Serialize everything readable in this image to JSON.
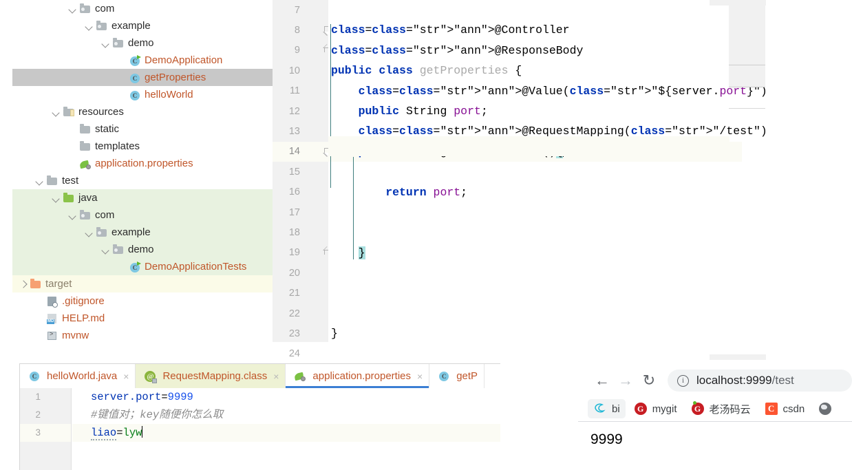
{
  "project_tree": {
    "items": [
      {
        "label": "com",
        "indent": 4,
        "icon": "package-folder-icon",
        "twisty": "down",
        "color": "dark"
      },
      {
        "label": "example",
        "indent": 5,
        "icon": "package-folder-icon",
        "twisty": "down",
        "color": "dark"
      },
      {
        "label": "demo",
        "indent": 6,
        "icon": "package-folder-icon",
        "twisty": "down",
        "color": "dark"
      },
      {
        "label": "DemoApplication",
        "indent": 7,
        "icon": "java-class-runnable-icon",
        "twisty": "none",
        "color": "orange"
      },
      {
        "label": "getProperties",
        "indent": 7,
        "icon": "java-class-icon",
        "twisty": "none",
        "color": "orange",
        "highlight": "selected"
      },
      {
        "label": "helloWorld",
        "indent": 7,
        "icon": "java-class-icon",
        "twisty": "none",
        "color": "orange"
      },
      {
        "label": "resources",
        "indent": 3,
        "icon": "resources-folder-icon",
        "twisty": "down",
        "color": "dark"
      },
      {
        "label": "static",
        "indent": 4,
        "icon": "folder-icon",
        "twisty": "none",
        "color": "dark"
      },
      {
        "label": "templates",
        "indent": 4,
        "icon": "folder-icon",
        "twisty": "none",
        "color": "dark"
      },
      {
        "label": "application.properties",
        "indent": 4,
        "icon": "spring-leaf-icon",
        "twisty": "none",
        "color": "orange"
      },
      {
        "label": "test",
        "indent": 2,
        "icon": "folder-icon",
        "twisty": "down",
        "color": "dark"
      },
      {
        "label": "java",
        "indent": 3,
        "icon": "source-folder-icon",
        "twisty": "down",
        "color": "dark",
        "highlight": "green"
      },
      {
        "label": "com",
        "indent": 4,
        "icon": "package-folder-icon",
        "twisty": "down",
        "color": "dark",
        "highlight": "green"
      },
      {
        "label": "example",
        "indent": 5,
        "icon": "package-folder-icon",
        "twisty": "down",
        "color": "dark",
        "highlight": "green"
      },
      {
        "label": "demo",
        "indent": 6,
        "icon": "package-folder-icon",
        "twisty": "down",
        "color": "dark",
        "highlight": "green"
      },
      {
        "label": "DemoApplicationTests",
        "indent": 7,
        "icon": "java-class-runnable-icon",
        "twisty": "none",
        "color": "orange",
        "highlight": "green"
      },
      {
        "label": "target",
        "indent": 1,
        "icon": "excluded-folder-icon",
        "twisty": "right",
        "color": "gray",
        "highlight": "yellow"
      },
      {
        "label": ".gitignore",
        "indent": 2,
        "icon": "gitignore-icon",
        "twisty": "none",
        "color": "orange"
      },
      {
        "label": "HELP.md",
        "indent": 2,
        "icon": "markdown-icon",
        "twisty": "none",
        "color": "orange"
      },
      {
        "label": "mvnw",
        "indent": 2,
        "icon": "shell-script-icon",
        "twisty": "none",
        "color": "orange"
      }
    ]
  },
  "code_editor": {
    "line_numbers": [
      "7",
      "8",
      "9",
      "10",
      "11",
      "12",
      "13",
      "14",
      "15",
      "16",
      "17",
      "18",
      "19",
      "20",
      "21",
      "22",
      "23",
      "24"
    ],
    "active_line": "14",
    "lines": [
      {
        "num": "7",
        "text": ""
      },
      {
        "num": "8",
        "text": "@Controller"
      },
      {
        "num": "9",
        "text": "@ResponseBody"
      },
      {
        "num": "10",
        "text": "public class getProperties {"
      },
      {
        "num": "11",
        "text": "    @Value(\"${server.port}\")"
      },
      {
        "num": "12",
        "text": "    public String port;"
      },
      {
        "num": "13",
        "text": "    @RequestMapping(\"/test\")"
      },
      {
        "num": "14",
        "text": "    public String testConstruct(){"
      },
      {
        "num": "15",
        "text": ""
      },
      {
        "num": "16",
        "text": "        return port;"
      },
      {
        "num": "17",
        "text": ""
      },
      {
        "num": "18",
        "text": ""
      },
      {
        "num": "19",
        "text": "    }"
      },
      {
        "num": "20",
        "text": ""
      },
      {
        "num": "21",
        "text": ""
      },
      {
        "num": "22",
        "text": ""
      },
      {
        "num": "23",
        "text": "}"
      },
      {
        "num": "24",
        "text": ""
      }
    ]
  },
  "bottom_panel": {
    "tabs": [
      {
        "label": "helloWorld.java",
        "icon": "java-class-icon",
        "close": "×",
        "state": "normal"
      },
      {
        "label": "RequestMapping.class",
        "icon": "annotation-class-icon",
        "close": "×",
        "state": "decompiled"
      },
      {
        "label": "application.properties",
        "icon": "spring-leaf-icon",
        "close": "×",
        "state": "active"
      },
      {
        "label": "getP",
        "icon": "java-class-icon",
        "close": "",
        "state": "clipped"
      }
    ],
    "line_numbers": [
      "1",
      "2",
      "3"
    ],
    "active_line": "3",
    "lines": [
      {
        "num": "1",
        "key": "server.port",
        "eq": "=",
        "value": "9999",
        "kind": "property"
      },
      {
        "num": "2",
        "text": "#键值对；key随便你怎么取",
        "kind": "comment"
      },
      {
        "num": "3",
        "key": "liao",
        "eq": "=",
        "value": "lyw",
        "kind": "property"
      }
    ]
  },
  "browser": {
    "back_icon": "←",
    "forward_icon": "→",
    "reload_icon": "↻",
    "site_info_icon": "i",
    "url_host": "localhost:9999",
    "url_path": "/test",
    "bookmarks": [
      {
        "label": "bi",
        "icon": "bi-icon"
      },
      {
        "label": "mygit",
        "icon": "gitee-icon"
      },
      {
        "label": "老汤码云",
        "icon": "gitee-dot-icon"
      },
      {
        "label": "csdn",
        "icon": "csdn-icon"
      },
      {
        "label": "",
        "icon": "globe-icon"
      }
    ],
    "page_content": "9999"
  },
  "colors": {
    "selection_gray": "#c8c8c8",
    "green_highlight": "#e8f2e0",
    "yellow_highlight": "#fbfbe8",
    "tab_accent": "#3b7fd4",
    "label_orange": "#c0562a",
    "keyword_blue": "#0033b3",
    "annotation_gold": "#9e880d",
    "string_green": "#067d17",
    "field_purple": "#871094",
    "caret_selection": "#a9e0e0"
  }
}
